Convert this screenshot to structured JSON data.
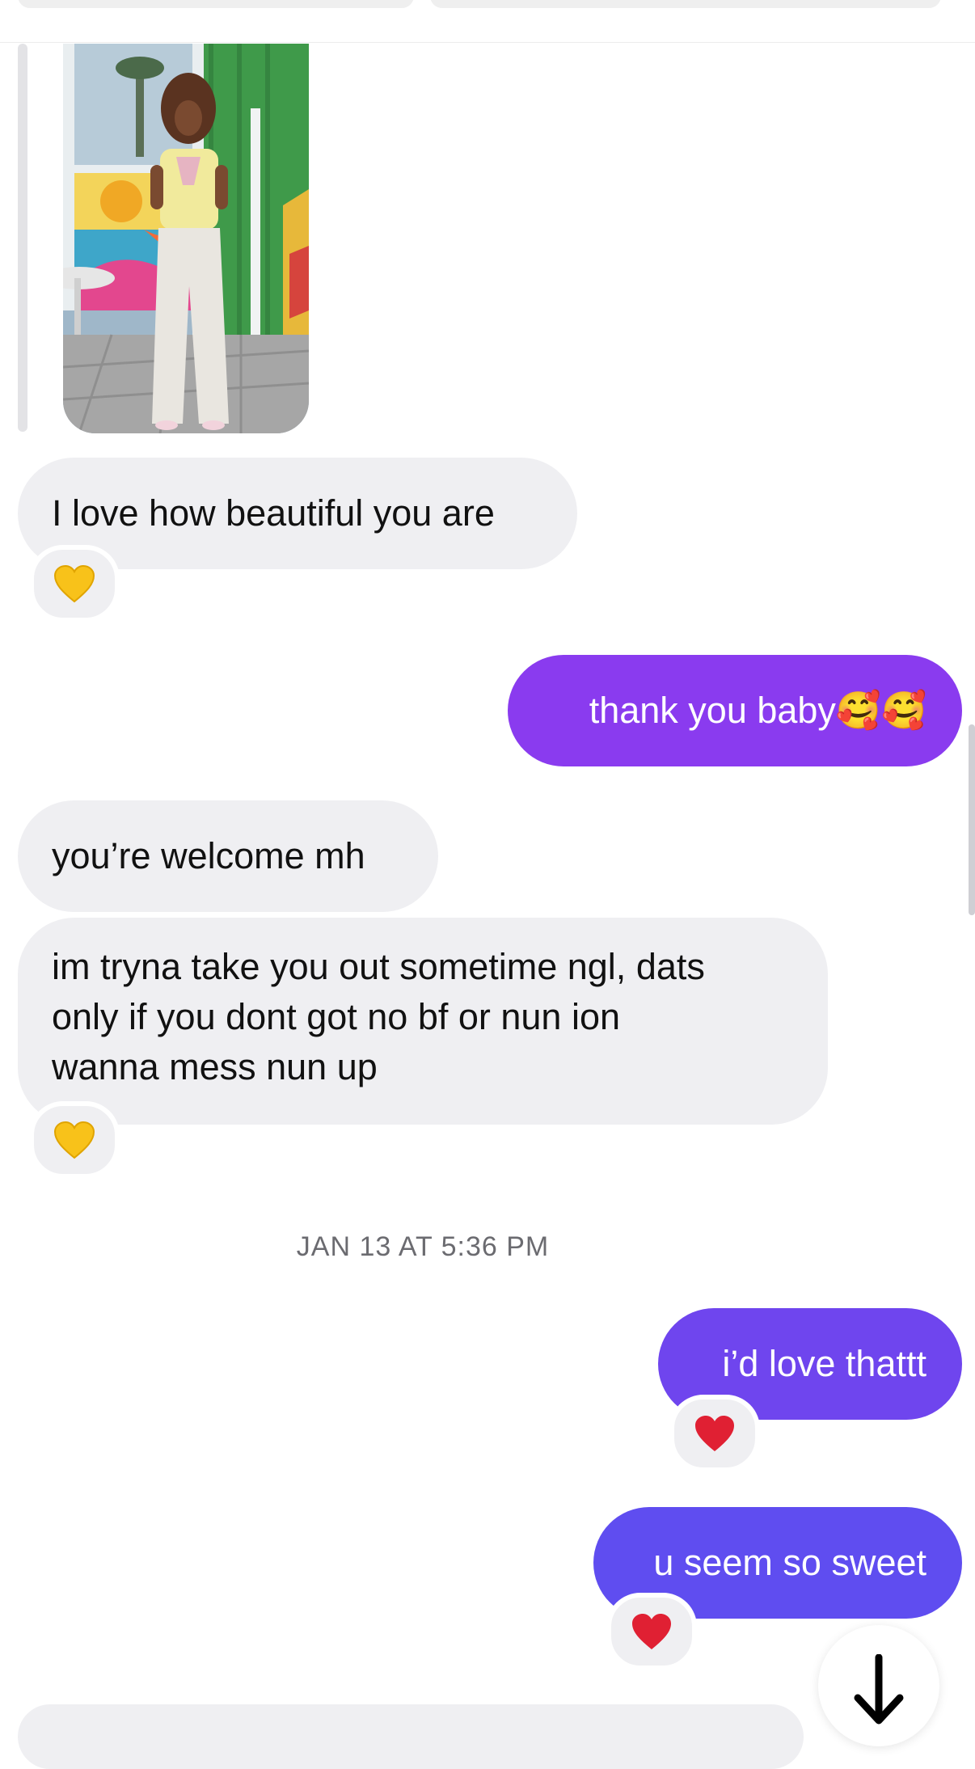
{
  "messages": {
    "m1": {
      "text": "I love how beautiful you are",
      "reaction": "yellow-heart"
    },
    "m2": {
      "text": "thank you baby🥰🥰"
    },
    "m3": {
      "text": "you’re welcome mh"
    },
    "m4": {
      "lines": [
        "im tryna take you out sometime ngl, dats",
        "only if you dont got no bf or nun ion",
        "wanna mess nun up"
      ],
      "reaction": "yellow-heart"
    },
    "timestamp": "JAN 13 AT 5:36 PM",
    "m5": {
      "text": "i’d love thattt",
      "reaction": "red-heart"
    },
    "m6": {
      "text": "u seem so sweet",
      "reaction": "red-heart"
    }
  },
  "colors": {
    "incoming_bubble": "#efeff2",
    "outgoing_bubble_1": "#8a3bef",
    "outgoing_bubble_2": "#6f45ee",
    "outgoing_bubble_3": "#5f4df0",
    "timestamp": "#6b6b70",
    "yellow_heart": "#f8c21a",
    "red_heart": "#e02033"
  },
  "icons": {
    "scroll_down": "arrow-down-icon"
  }
}
